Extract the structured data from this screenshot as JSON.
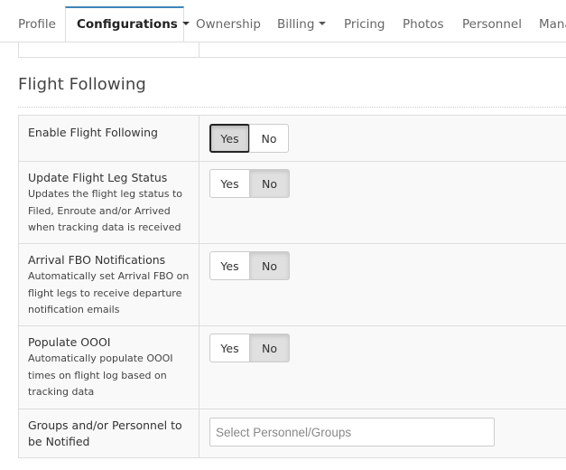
{
  "tabs": [
    {
      "label": "Profile",
      "dropdown": false,
      "active": false
    },
    {
      "label": "Configurations",
      "dropdown": true,
      "active": true
    },
    {
      "label": "Ownership",
      "dropdown": false,
      "active": false
    },
    {
      "label": "Billing",
      "dropdown": true,
      "active": false
    },
    {
      "label": "Pricing",
      "dropdown": false,
      "active": false
    },
    {
      "label": "Photos",
      "dropdown": false,
      "active": false
    },
    {
      "label": "Personnel",
      "dropdown": false,
      "active": false
    },
    {
      "label": "Mana",
      "dropdown": false,
      "active": false
    }
  ],
  "section": {
    "title": "Flight Following"
  },
  "settings": [
    {
      "label": "Enable Flight Following",
      "description": "",
      "yes": "Yes",
      "no": "No",
      "selected": "yes"
    },
    {
      "label": "Update Flight Leg Status",
      "description": "Updates the flight leg status to Filed, Enroute and/or Arrived when tracking data is received",
      "yes": "Yes",
      "no": "No",
      "selected": "no"
    },
    {
      "label": "Arrival FBO Notifications",
      "description": "Automatically set Arrival FBO on flight legs to receive departure notification emails",
      "yes": "Yes",
      "no": "No",
      "selected": "no"
    },
    {
      "label": "Populate OOOI",
      "description": "Automatically populate OOOI times on flight log based on tracking data",
      "yes": "Yes",
      "no": "No",
      "selected": "no"
    }
  ],
  "notify": {
    "label": "Groups and/or Personnel to be Notified",
    "placeholder": "Select Personnel/Groups",
    "value": ""
  },
  "colors": {
    "accent": "#3d86b7",
    "border": "#dddddd",
    "row_bg": "#f9f9f9",
    "selected_bg": "#e0e0e0"
  }
}
